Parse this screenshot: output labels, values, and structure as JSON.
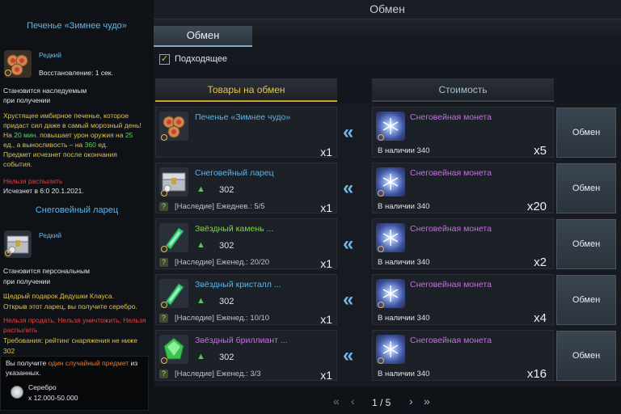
{
  "window_title": "Обмен",
  "tab": "Обмен",
  "filter": {
    "label": "Подходящее",
    "checked": true
  },
  "headers": {
    "goods": "Товары на обмен",
    "cost": "Стоимость"
  },
  "tooltip1": {
    "title": "Печенье «Зимнее чудо»",
    "rarity": "Редкий",
    "cooldown": "Восстановление: 1 сек.",
    "bind": [
      "Становится наследуемым",
      "при получении"
    ],
    "desc": [
      "Хрустящее имбирное печенье, которое",
      "придаст сил даже в самый морозный день!"
    ],
    "effect_a": "На ",
    "effect_b": "20 мин.",
    "effect_c": " повышает урон оружия на ",
    "effect_d": "25",
    "effect_e": "ед., а выносливость – на ",
    "effect_f": "360",
    "effect_g": " ед.",
    "expire": [
      "Предмет исчезнет после окончания",
      "события."
    ],
    "restriction": "Нельзя распылить",
    "expiry_date": "Исчезнет в 6:0 20.1.2021."
  },
  "tooltip2": {
    "title": "Снеговейный ларец",
    "rarity": "Редкий",
    "bind": [
      "Становится персональным",
      "при получении"
    ],
    "desc": [
      "Щедрый подарок Дедушки Клауса.",
      "Открыв этот ларец, вы получите серебро."
    ],
    "restriction_1": "Нельзя продать",
    "restriction_2": "Нельзя уничтожить",
    "restriction_3": "Нельзя",
    "restriction_4": "распылить",
    "req": "Требования: рейтинг снаряжения не ниже",
    "req_value": "302",
    "reward_a": "Вы получите ",
    "reward_b": "один случайный предмет",
    "reward_c": " из",
    "reward_d": "указанных.",
    "reward_name": "Серебро",
    "reward_amount": "x 12.000-50.000"
  },
  "rows": [
    {
      "name": "Печенье «Зимнее чудо»",
      "name_color": "#5fb4e8",
      "power": "",
      "footer": "",
      "qty": "x1",
      "cost_name": "Снеговейная монета",
      "stock": "В наличии 340",
      "cost_qty": "x5",
      "button": "Обмен",
      "icon": "cookie-icon"
    },
    {
      "name": "Снеговейный ларец",
      "name_color": "#5fb4e8",
      "power": "302",
      "footer": "[Наследие] Ежеднев.: 5/5",
      "qty": "x1",
      "cost_name": "Снеговейная монета",
      "stock": "В наличии 340",
      "cost_qty": "x20",
      "button": "Обмен",
      "icon": "chest-icon"
    },
    {
      "name": "Звёздный камень ...",
      "name_color": "#7fd840",
      "power": "302",
      "footer": "[Наследие] Еженед.: 20/20",
      "qty": "x1",
      "cost_name": "Снеговейная монета",
      "stock": "В наличии 340",
      "cost_qty": "x2",
      "button": "Обмен",
      "icon": "crystal-icon"
    },
    {
      "name": "Звёздный кристалл ...",
      "name_color": "#5fb4e8",
      "power": "302",
      "footer": "[Наследие] Еженед.: 10/10",
      "qty": "x1",
      "cost_name": "Снеговейная монета",
      "stock": "В наличии 340",
      "cost_qty": "x4",
      "button": "Обмен",
      "icon": "crystal-icon"
    },
    {
      "name": "Звёздный бриллиант ...",
      "name_color": "#c66ee4",
      "power": "302",
      "footer": "[Наследие] Еженед.: 3/3",
      "qty": "x1",
      "cost_name": "Снеговейная монета",
      "stock": "В наличии 340",
      "cost_qty": "x16",
      "button": "Обмен",
      "icon": "gem-icon"
    }
  ],
  "pager": {
    "text": "1 / 5"
  }
}
